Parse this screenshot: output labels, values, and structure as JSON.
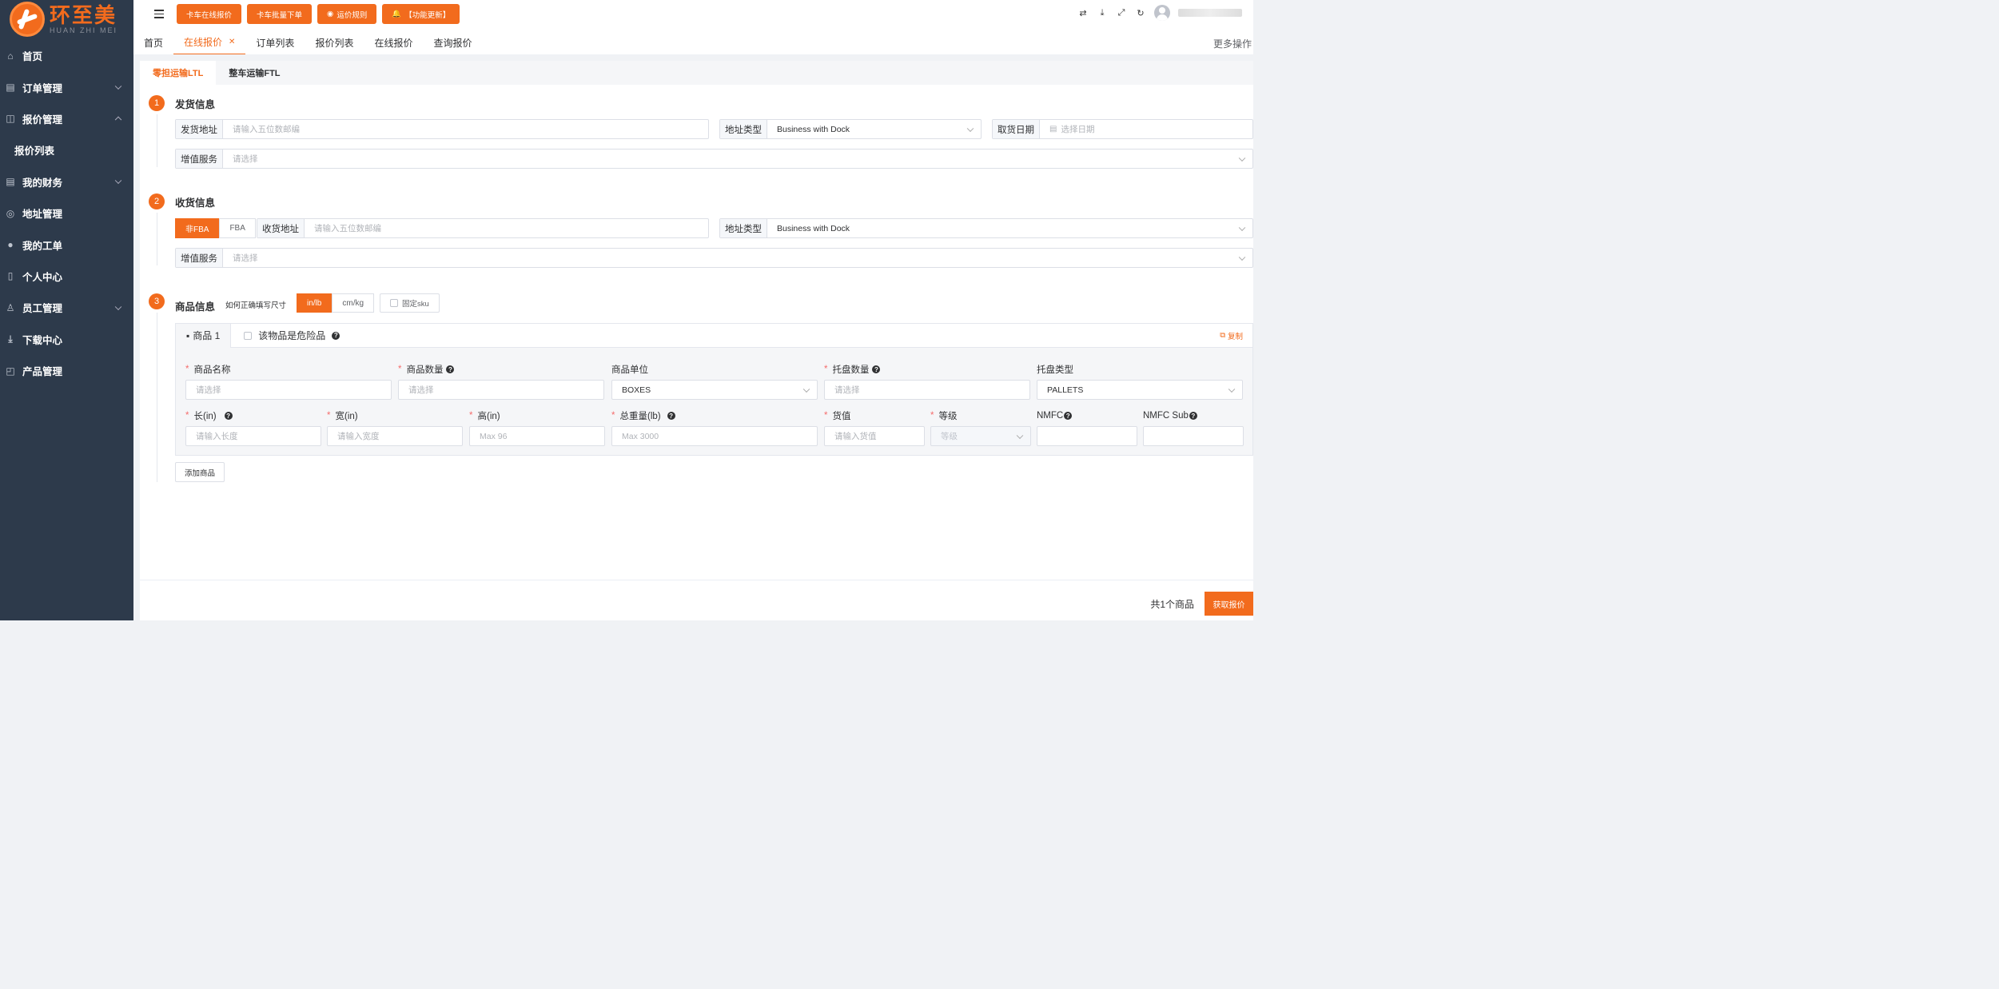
{
  "logo": {
    "cn": "环至美",
    "en": "HUAN ZHI MEI"
  },
  "sidebar": {
    "items": [
      {
        "label": "首页",
        "icon": "home-icon"
      },
      {
        "label": "订单管理",
        "icon": "order-icon"
      },
      {
        "label": "报价管理",
        "icon": "book-icon"
      },
      {
        "label": "报价列表"
      },
      {
        "label": "我的财务",
        "icon": "finance-icon"
      },
      {
        "label": "地址管理",
        "icon": "location-icon"
      },
      {
        "label": "我的工单",
        "icon": "ticket-icon"
      },
      {
        "label": "个人中心",
        "icon": "phone-icon"
      },
      {
        "label": "员工管理",
        "icon": "user-icon"
      },
      {
        "label": "下载中心",
        "icon": "download-icon"
      },
      {
        "label": "产品管理",
        "icon": "box-icon"
      }
    ]
  },
  "header": {
    "buttons": [
      "卡车在线报价",
      "卡车批量下单",
      "运价规则",
      "【功能更新】"
    ],
    "tabs": [
      "首页",
      "在线报价",
      "订单列表",
      "报价列表",
      "在线报价",
      "查询报价"
    ],
    "more": "更多操作"
  },
  "subtabs": [
    "零担运输LTL",
    "整车运输FTL"
  ],
  "shipper": {
    "num": "1",
    "title": "发货信息",
    "address_label": "发货地址",
    "address_placeholder": "请输入五位数邮编",
    "type_label": "地址类型",
    "type_value": "Business with Dock",
    "date_label": "取货日期",
    "date_placeholder": "选择日期",
    "service_label": "增值服务",
    "service_placeholder": "请选择"
  },
  "receiver": {
    "num": "2",
    "title": "收货信息",
    "seg": [
      "非FBA",
      "FBA"
    ],
    "address_label": "收货地址",
    "address_placeholder": "请输入五位数邮编",
    "type_label": "地址类型",
    "type_value": "Business with Dock",
    "service_label": "增值服务",
    "service_placeholder": "请选择"
  },
  "goods": {
    "num": "3",
    "title": "商品信息",
    "hint": "如何正确填写尺寸",
    "units": [
      "in/lb",
      "cm/kg"
    ],
    "fixed_sku": "固定sku",
    "tab": "商品 1",
    "danger": "该物品是危险品",
    "copy": "复制",
    "fields": {
      "name": {
        "label": "商品名称",
        "placeholder": "请选择"
      },
      "qty": {
        "label": "商品数量",
        "placeholder": "请选择"
      },
      "unit": {
        "label": "商品单位",
        "value": "BOXES"
      },
      "pallet_qty": {
        "label": "托盘数量",
        "placeholder": "请选择"
      },
      "pallet_type": {
        "label": "托盘类型",
        "value": "PALLETS"
      },
      "length": {
        "label": "长(in)",
        "placeholder": "请输入长度"
      },
      "width": {
        "label": "宽(in)",
        "placeholder": "请输入宽度"
      },
      "height": {
        "label": "高(in)",
        "placeholder": "Max 96"
      },
      "weight": {
        "label": "总重量(lb)",
        "placeholder": "Max 3000"
      },
      "value": {
        "label": "货值",
        "placeholder": "请输入货值"
      },
      "grade": {
        "label": "等级",
        "placeholder": "等级"
      },
      "nmfc": {
        "label": "NMFC"
      },
      "nmfc_sub": {
        "label": "NMFC Sub"
      }
    },
    "add": "添加商品"
  },
  "footer": {
    "total": "共1个商品",
    "submit": "获取报价"
  },
  "colors": {
    "accent": "#f26b1d",
    "sidebar": "#2d3a4b"
  }
}
